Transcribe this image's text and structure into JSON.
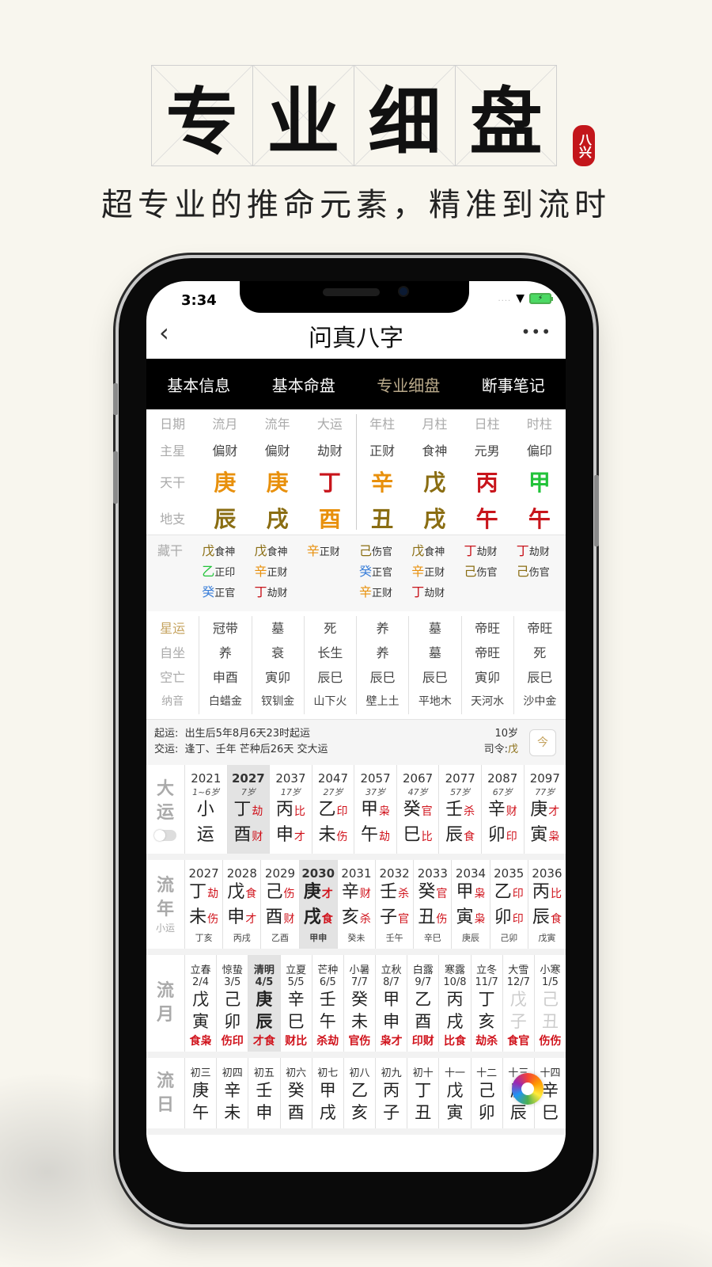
{
  "hero": {
    "title_chars": [
      "专",
      "业",
      "细",
      "盘"
    ],
    "seal_text": "八兴",
    "subtitle": "超专业的推命元素，精准到流时"
  },
  "status_bar": {
    "time": "3:34",
    "signal": "....",
    "wifi_icon": "wifi-icon",
    "battery_icon": "battery-charging-icon"
  },
  "nav": {
    "back_icon": "chevron-left-icon",
    "title": "问真八字",
    "more_icon": "more-dots-icon"
  },
  "tabs": [
    {
      "label": "基本信息",
      "active": false
    },
    {
      "label": "基本命盘",
      "active": false
    },
    {
      "label": "专业细盘",
      "active": true
    },
    {
      "label": "断事笔记",
      "active": false
    }
  ],
  "pillars": {
    "row_labels": [
      "日期",
      "主星",
      "天干",
      "地支"
    ],
    "columns": [
      {
        "head": "流月",
        "star": "偏财",
        "stem": "庚",
        "stem_color": "#e8900c",
        "branch": "辰",
        "branch_color": "#8a6d12"
      },
      {
        "head": "流年",
        "star": "偏财",
        "stem": "庚",
        "stem_color": "#e8900c",
        "branch": "戌",
        "branch_color": "#8a6d12"
      },
      {
        "head": "大运",
        "star": "劫财",
        "stem": "丁",
        "stem_color": "#c8141b",
        "branch": "酉",
        "branch_color": "#e8900c"
      },
      {
        "head": "年柱",
        "star": "正财",
        "stem": "辛",
        "stem_color": "#e8900c",
        "branch": "丑",
        "branch_color": "#8a6d12"
      },
      {
        "head": "月柱",
        "star": "食神",
        "stem": "戊",
        "stem_color": "#8a6d12",
        "branch": "戌",
        "branch_color": "#8a6d12"
      },
      {
        "head": "日柱",
        "star": "元男",
        "stem": "丙",
        "stem_color": "#c8141b",
        "branch": "午",
        "branch_color": "#c8141b"
      },
      {
        "head": "时柱",
        "star": "偏印",
        "stem": "甲",
        "stem_color": "#22c33a",
        "branch": "午",
        "branch_color": "#c8141b"
      }
    ]
  },
  "canggan": {
    "label": "藏干",
    "columns": [
      [
        {
          "stem": "戊",
          "god": "食神",
          "color": "#8a6d12"
        },
        {
          "stem": "乙",
          "god": "正印",
          "color": "#22c33a"
        },
        {
          "stem": "癸",
          "god": "正官",
          "color": "#3b7fd9"
        }
      ],
      [
        {
          "stem": "戊",
          "god": "食神",
          "color": "#8a6d12"
        },
        {
          "stem": "辛",
          "god": "正财",
          "color": "#e8900c"
        },
        {
          "stem": "丁",
          "god": "劫财",
          "color": "#c8141b"
        }
      ],
      [
        {
          "stem": "辛",
          "god": "正财",
          "color": "#e8900c"
        }
      ],
      [
        {
          "stem": "己",
          "god": "伤官",
          "color": "#8a6d12"
        },
        {
          "stem": "癸",
          "god": "正官",
          "color": "#3b7fd9"
        },
        {
          "stem": "辛",
          "god": "正财",
          "color": "#e8900c"
        }
      ],
      [
        {
          "stem": "戊",
          "god": "食神",
          "color": "#8a6d12"
        },
        {
          "stem": "辛",
          "god": "正财",
          "color": "#e8900c"
        },
        {
          "stem": "丁",
          "god": "劫财",
          "color": "#c8141b"
        }
      ],
      [
        {
          "stem": "丁",
          "god": "劫财",
          "color": "#c8141b"
        },
        {
          "stem": "己",
          "god": "伤官",
          "color": "#8a6d12"
        }
      ],
      [
        {
          "stem": "丁",
          "god": "劫财",
          "color": "#c8141b"
        },
        {
          "stem": "己",
          "god": "伤官",
          "color": "#8a6d12"
        }
      ]
    ]
  },
  "xingyun": {
    "labels": [
      "星运",
      "自坐",
      "空亡",
      "纳音"
    ],
    "columns": [
      [
        "冠带",
        "养",
        "申酉",
        "白蜡金"
      ],
      [
        "墓",
        "衰",
        "寅卯",
        "钗钏金"
      ],
      [
        "死",
        "长生",
        "辰巳",
        "山下火"
      ],
      [
        "养",
        "养",
        "辰巳",
        "壁上土"
      ],
      [
        "墓",
        "墓",
        "辰巳",
        "平地木"
      ],
      [
        "帝旺",
        "帝旺",
        "寅卯",
        "天河水"
      ],
      [
        "帝旺",
        "死",
        "辰巳",
        "沙中金"
      ]
    ]
  },
  "qiyun": {
    "line1_label": "起运:",
    "line1_value": "出生后5年8月6天23时起运",
    "line2_label": "交运:",
    "line2_value": "逢丁、壬年 芒种后26天 交大运",
    "age": "10岁",
    "siling_label": "司令:",
    "siling_value": "戊",
    "today_icon": "calendar-today-icon",
    "today_label": "今"
  },
  "dayun": {
    "label": [
      "大",
      "运"
    ],
    "columns": [
      {
        "year": "2021",
        "age": "1~6岁",
        "stem": "小",
        "stem_god": "",
        "branch": "运",
        "branch_god": "",
        "highlight": false
      },
      {
        "year": "2027",
        "age": "7岁",
        "stem": "丁",
        "stem_god": "劫",
        "branch": "酉",
        "branch_god": "财",
        "highlight": true
      },
      {
        "year": "2037",
        "age": "17岁",
        "stem": "丙",
        "stem_god": "比",
        "branch": "申",
        "branch_god": "才",
        "highlight": false
      },
      {
        "year": "2047",
        "age": "27岁",
        "stem": "乙",
        "stem_god": "印",
        "branch": "未",
        "branch_god": "伤",
        "highlight": false
      },
      {
        "year": "2057",
        "age": "37岁",
        "stem": "甲",
        "stem_god": "枭",
        "branch": "午",
        "branch_god": "劫",
        "highlight": false
      },
      {
        "year": "2067",
        "age": "47岁",
        "stem": "癸",
        "stem_god": "官",
        "branch": "巳",
        "branch_god": "比",
        "highlight": false
      },
      {
        "year": "2077",
        "age": "57岁",
        "stem": "壬",
        "stem_god": "杀",
        "branch": "辰",
        "branch_god": "食",
        "highlight": false
      },
      {
        "year": "2087",
        "age": "67岁",
        "stem": "辛",
        "stem_god": "财",
        "branch": "卯",
        "branch_god": "印",
        "highlight": false
      },
      {
        "year": "2097",
        "age": "77岁",
        "stem": "庚",
        "stem_god": "才",
        "branch": "寅",
        "branch_god": "枭",
        "highlight": false
      }
    ]
  },
  "liunian": {
    "label": [
      "流",
      "年"
    ],
    "sub_label": "小运",
    "columns": [
      {
        "year": "2027",
        "stem": "丁",
        "stem_god": "劫",
        "branch": "未",
        "branch_god": "伤",
        "xiaoyun": "丁亥",
        "highlight": false
      },
      {
        "year": "2028",
        "stem": "戊",
        "stem_god": "食",
        "branch": "申",
        "branch_god": "才",
        "xiaoyun": "丙戌",
        "highlight": false
      },
      {
        "year": "2029",
        "stem": "己",
        "stem_god": "伤",
        "branch": "酉",
        "branch_god": "财",
        "xiaoyun": "乙酉",
        "highlight": false
      },
      {
        "year": "2030",
        "stem": "庚",
        "stem_god": "才",
        "branch": "戌",
        "branch_god": "食",
        "xiaoyun": "甲申",
        "highlight": true
      },
      {
        "year": "2031",
        "stem": "辛",
        "stem_god": "财",
        "branch": "亥",
        "branch_god": "杀",
        "xiaoyun": "癸未",
        "highlight": false
      },
      {
        "year": "2032",
        "stem": "壬",
        "stem_god": "杀",
        "branch": "子",
        "branch_god": "官",
        "xiaoyun": "壬午",
        "highlight": false
      },
      {
        "year": "2033",
        "stem": "癸",
        "stem_god": "官",
        "branch": "丑",
        "branch_god": "伤",
        "xiaoyun": "辛巳",
        "highlight": false
      },
      {
        "year": "2034",
        "stem": "甲",
        "stem_god": "枭",
        "branch": "寅",
        "branch_god": "枭",
        "xiaoyun": "庚辰",
        "highlight": false
      },
      {
        "year": "2035",
        "stem": "乙",
        "stem_god": "印",
        "branch": "卯",
        "branch_god": "印",
        "xiaoyun": "己卯",
        "highlight": false
      },
      {
        "year": "2036",
        "stem": "丙",
        "stem_god": "比",
        "branch": "辰",
        "branch_god": "食",
        "xiaoyun": "戊寅",
        "highlight": false
      }
    ]
  },
  "liuyue": {
    "label": [
      "流",
      "月"
    ],
    "columns": [
      {
        "term": "立春",
        "date": "2/4",
        "stem": "戊",
        "branch": "寅",
        "gods": "食枭",
        "highlight": false
      },
      {
        "term": "惊蛰",
        "date": "3/5",
        "stem": "己",
        "branch": "卯",
        "gods": "伤印",
        "highlight": false
      },
      {
        "term": "清明",
        "date": "4/5",
        "stem": "庚",
        "branch": "辰",
        "gods": "才食",
        "highlight": true
      },
      {
        "term": "立夏",
        "date": "5/5",
        "stem": "辛",
        "branch": "巳",
        "gods": "财比",
        "highlight": false
      },
      {
        "term": "芒种",
        "date": "6/5",
        "stem": "壬",
        "branch": "午",
        "gods": "杀劫",
        "highlight": false
      },
      {
        "term": "小暑",
        "date": "7/7",
        "stem": "癸",
        "branch": "未",
        "gods": "官伤",
        "highlight": false
      },
      {
        "term": "立秋",
        "date": "8/7",
        "stem": "甲",
        "branch": "申",
        "gods": "枭才",
        "highlight": false
      },
      {
        "term": "白露",
        "date": "9/7",
        "stem": "乙",
        "branch": "酉",
        "gods": "印财",
        "highlight": false
      },
      {
        "term": "寒露",
        "date": "10/8",
        "stem": "丙",
        "branch": "戌",
        "gods": "比食",
        "highlight": false
      },
      {
        "term": "立冬",
        "date": "11/7",
        "stem": "丁",
        "branch": "亥",
        "gods": "劫杀",
        "highlight": false
      },
      {
        "term": "大雪",
        "date": "12/7",
        "stem": "戊",
        "branch": "子",
        "gods": "食官",
        "highlight": false,
        "faded": true
      },
      {
        "term": "小寒",
        "date": "1/5",
        "stem": "己",
        "branch": "丑",
        "gods": "伤伤",
        "highlight": false,
        "faded": true
      }
    ]
  },
  "liuri": {
    "label": [
      "流",
      "日"
    ],
    "columns": [
      {
        "day": "初三",
        "stem": "庚",
        "branch": "午"
      },
      {
        "day": "初四",
        "stem": "辛",
        "branch": "未"
      },
      {
        "day": "初五",
        "stem": "壬",
        "branch": "申"
      },
      {
        "day": "初六",
        "stem": "癸",
        "branch": "酉"
      },
      {
        "day": "初七",
        "stem": "甲",
        "branch": "戌"
      },
      {
        "day": "初八",
        "stem": "乙",
        "branch": "亥"
      },
      {
        "day": "初九",
        "stem": "丙",
        "branch": "子"
      },
      {
        "day": "初十",
        "stem": "丁",
        "branch": "丑"
      },
      {
        "day": "十一",
        "stem": "戊",
        "branch": "寅"
      },
      {
        "day": "十二",
        "stem": "己",
        "branch": "卯"
      },
      {
        "day": "十三",
        "stem": "庚",
        "branch": "辰"
      },
      {
        "day": "十四",
        "stem": "辛",
        "branch": "巳"
      }
    ]
  },
  "floating_button": {
    "icon": "camera-shutter-icon"
  }
}
